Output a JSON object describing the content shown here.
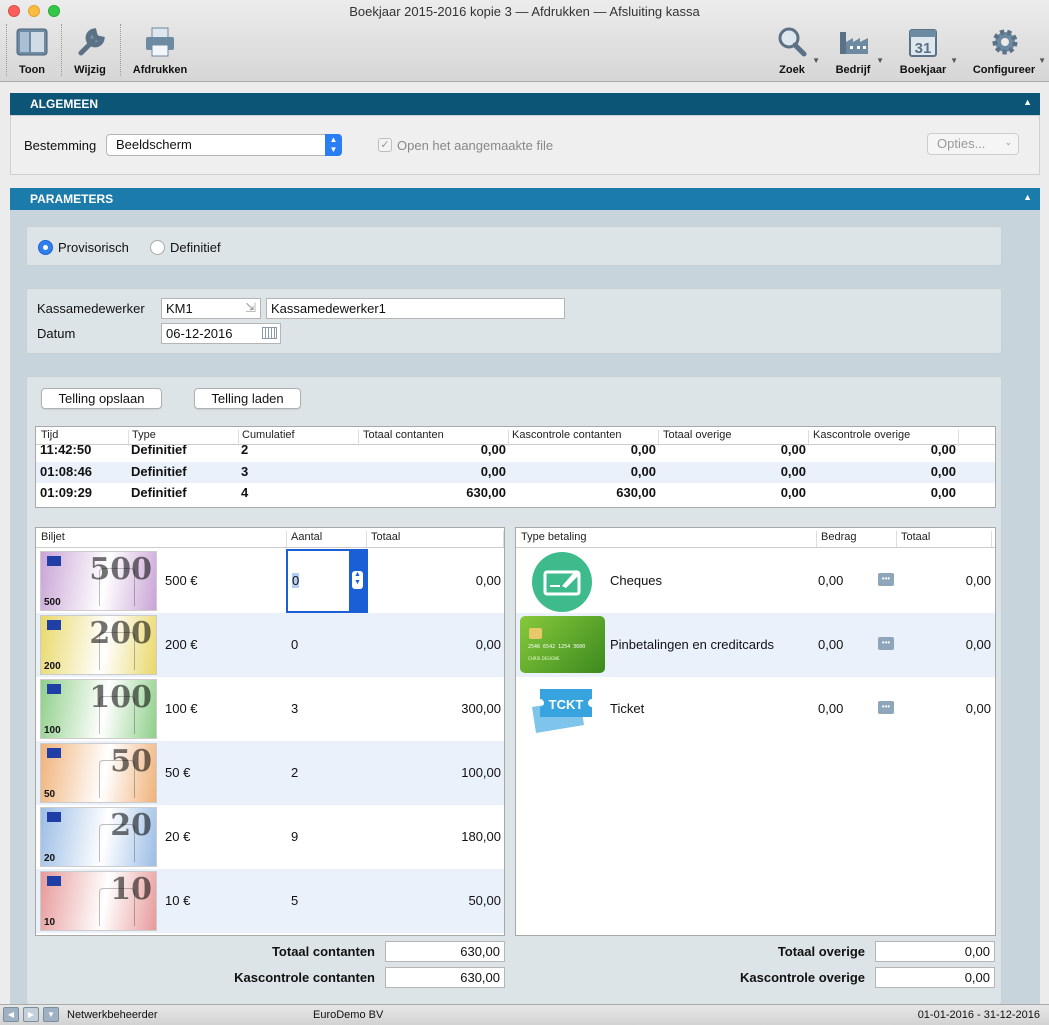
{
  "window": {
    "title": "Boekjaar 2015-2016 kopie 3 — Afdrukken — Afsluiting kassa",
    "traffic_colors": [
      "#fc605c",
      "#fdbc40",
      "#34c84a"
    ]
  },
  "toolbar": {
    "left": [
      {
        "label": "Toon",
        "icon": "sidebar-icon"
      },
      {
        "label": "Wijzig",
        "icon": "wrench-icon"
      },
      {
        "label": "Afdrukken",
        "icon": "printer-icon"
      }
    ],
    "right": [
      {
        "label": "Zoek",
        "icon": "magnifier-icon"
      },
      {
        "label": "Bedrijf",
        "icon": "factory-icon"
      },
      {
        "label": "Boekjaar",
        "icon": "calendar-icon",
        "icon_text": "31"
      },
      {
        "label": "Configureer",
        "icon": "gear-icon"
      }
    ]
  },
  "algemeen": {
    "header": "ALGEMEEN",
    "bestemming_label": "Bestemming",
    "bestemming_value": "Beeldscherm",
    "open_file_label": "Open het aangemaakte file",
    "open_file_checked": true,
    "opties_label": "Opties..."
  },
  "parameters": {
    "header": "PARAMETERS",
    "radio_provisorisch": "Provisorisch",
    "radio_definitief": "Definitief",
    "selected": "Provisorisch",
    "kassamedewerker_label": "Kassamedewerker",
    "kassamedewerker_code": "KM1",
    "kassamedewerker_name": "Kassamedewerker1",
    "datum_label": "Datum",
    "datum_value": "06-12-2016"
  },
  "buttons": {
    "telling_opslaan": "Telling opslaan",
    "telling_laden": "Telling laden"
  },
  "history": {
    "columns": [
      "Tijd",
      "Type",
      "Cumulatief",
      "Totaal contanten",
      "Kascontrole contanten",
      "Totaal overige",
      "Kascontrole overige"
    ],
    "rows": [
      {
        "tijd": "11:42:50",
        "type": "Definitief",
        "cum": "2",
        "tc": "0,00",
        "kc": "0,00",
        "to": "0,00",
        "ko": "0,00"
      },
      {
        "tijd": "01:08:46",
        "type": "Definitief",
        "cum": "3",
        "tc": "0,00",
        "kc": "0,00",
        "to": "0,00",
        "ko": "0,00"
      },
      {
        "tijd": "01:09:29",
        "type": "Definitief",
        "cum": "4",
        "tc": "630,00",
        "kc": "630,00",
        "to": "0,00",
        "ko": "0,00"
      }
    ]
  },
  "biljetten": {
    "columns": [
      "Biljet",
      "Aantal",
      "Totaal"
    ],
    "rows": [
      {
        "label": "500 €",
        "aantal": "0",
        "totaal": "0,00",
        "note": "500",
        "small": "500",
        "color": "#c9a4d6"
      },
      {
        "label": "200 €",
        "aantal": "0",
        "totaal": "0,00",
        "note": "200",
        "small": "200",
        "color": "#e9d86a"
      },
      {
        "label": "100 €",
        "aantal": "3",
        "totaal": "300,00",
        "note": "100",
        "small": "100",
        "color": "#8fcf8a"
      },
      {
        "label": "50 €",
        "aantal": "2",
        "totaal": "100,00",
        "note": "50",
        "small": "50",
        "color": "#f0b27a"
      },
      {
        "label": "20 €",
        "aantal": "9",
        "totaal": "180,00",
        "note": "20",
        "small": "20",
        "color": "#9bbde6"
      },
      {
        "label": "10 €",
        "aantal": "5",
        "totaal": "50,00",
        "note": "10",
        "small": "10",
        "color": "#e79a9a"
      }
    ]
  },
  "betalingen": {
    "columns": [
      "Type betaling",
      "Bedrag",
      "Totaal"
    ],
    "rows": [
      {
        "label": "Cheques",
        "bedrag": "0,00",
        "totaal": "0,00",
        "icon": "cheque-icon"
      },
      {
        "label": "Pinbetalingen en creditcards",
        "bedrag": "0,00",
        "totaal": "0,00",
        "icon": "credit-card-icon",
        "card_number": "2546 6542 1254 3600",
        "card_holder": "CHRIS DESIGNE"
      },
      {
        "label": "Ticket",
        "bedrag": "0,00",
        "totaal": "0,00",
        "icon": "ticket-icon",
        "icon_text": "TCKT"
      }
    ]
  },
  "totals": {
    "totaal_contanten_label": "Totaal contanten",
    "totaal_contanten": "630,00",
    "kascontrole_contanten_label": "Kascontrole contanten",
    "kascontrole_contanten": "630,00",
    "totaal_overige_label": "Totaal overige",
    "totaal_overige": "0,00",
    "kascontrole_overige_label": "Kascontrole overige",
    "kascontrole_overige": "0,00"
  },
  "status": {
    "user": "Netwerkbeheerder",
    "company": "EuroDemo BV",
    "period": "01-01-2016 - 31-12-2016"
  },
  "colors": {
    "algemeen_header": "#0d5577",
    "parameters_header": "#1b7bab",
    "selection": "#1a5fd6"
  }
}
